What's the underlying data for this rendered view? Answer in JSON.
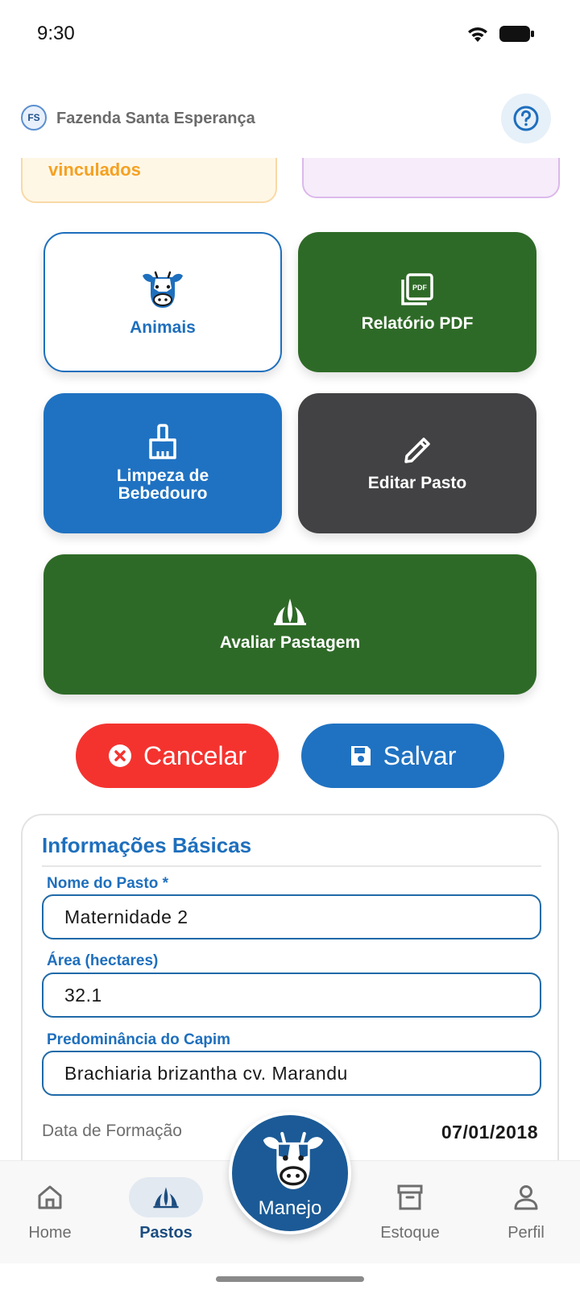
{
  "status_bar": {
    "time": "9:30"
  },
  "header": {
    "farm_initials": "FS",
    "farm_name": "Fazenda Santa Esperança",
    "help_icon": "help-circle-icon"
  },
  "summary_cards": {
    "left_text": "vinculados"
  },
  "actions": {
    "animais": {
      "label": "Animais",
      "icon": "cow-icon"
    },
    "relatorio": {
      "label": "Relatório PDF",
      "icon": "pdf-icon"
    },
    "limpeza": {
      "label": "Limpeza de Bebedouro",
      "icon": "broom-icon"
    },
    "editar": {
      "label": "Editar Pasto",
      "icon": "pencil-icon"
    },
    "avaliar": {
      "label": "Avaliar Pastagem",
      "icon": "grass-icon"
    }
  },
  "buttons": {
    "cancel_label": "Cancelar",
    "save_label": "Salvar"
  },
  "info": {
    "title": "Informações Básicas",
    "name_label": "Nome do Pasto *",
    "name_value": "Maternidade 2",
    "area_label": "Área (hectares)",
    "area_value": "32.1",
    "grass_label": "Predominância do Capim",
    "grass_value": "Brachiaria brizantha cv. Marandu",
    "formation_label": "Data de Formação",
    "formation_value": "07/01/2018"
  },
  "nav": {
    "home": "Home",
    "pastos": "Pastos",
    "manejo": "Manejo",
    "estoque": "Estoque",
    "perfil": "Perfil"
  },
  "colors": {
    "primary_blue": "#1f72c2",
    "green": "#2e6a27",
    "dark": "#424244",
    "red": "#f4332f",
    "navy": "#1b5a96"
  }
}
